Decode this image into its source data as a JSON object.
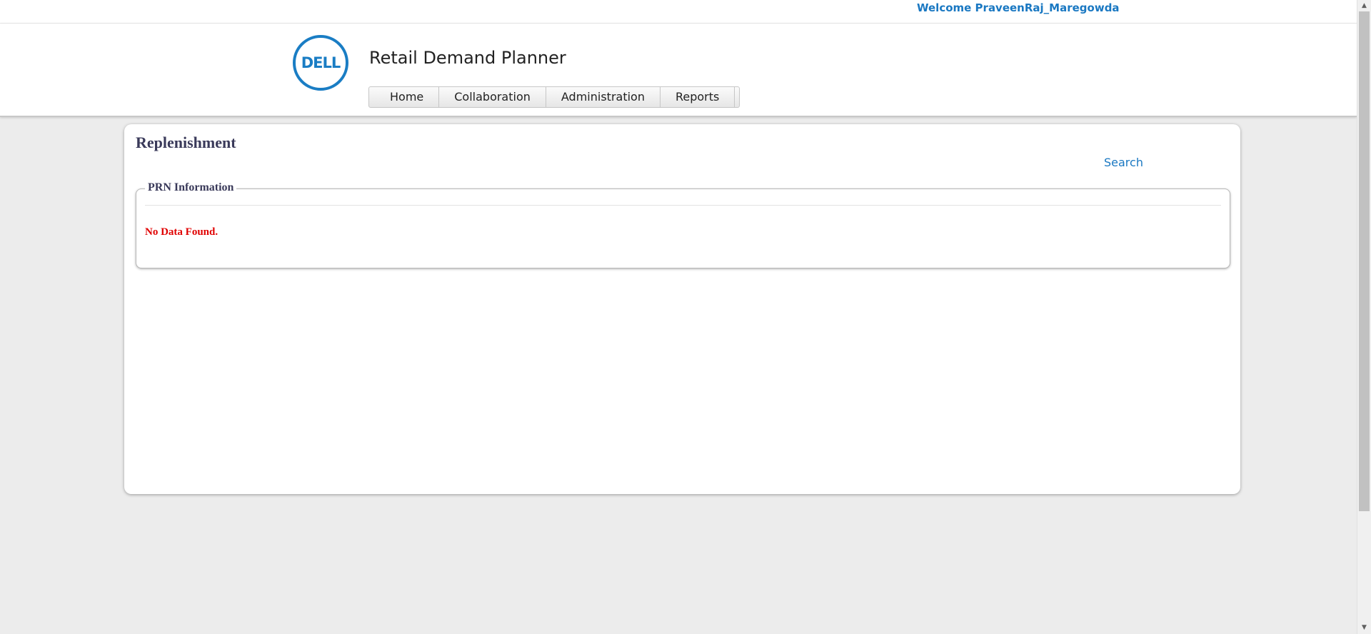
{
  "user": {
    "welcome_text": "Welcome PraveenRaj_Maregowda"
  },
  "header": {
    "logo_text": "DELL",
    "app_title": "Retail Demand Planner",
    "brand_color": "#1a7dc4"
  },
  "nav": {
    "items": [
      {
        "label": "Home"
      },
      {
        "label": "Collaboration"
      },
      {
        "label": "Administration"
      },
      {
        "label": "Reports"
      }
    ]
  },
  "main": {
    "title": "Replenishment",
    "search_label": "Search",
    "section": {
      "legend": "PRN Information",
      "empty_message": "No Data Found.",
      "empty_color": "#e00000"
    }
  },
  "scrollbar": {
    "up_icon": "scroll-up-arrow-icon",
    "down_icon": "scroll-down-arrow-icon"
  }
}
